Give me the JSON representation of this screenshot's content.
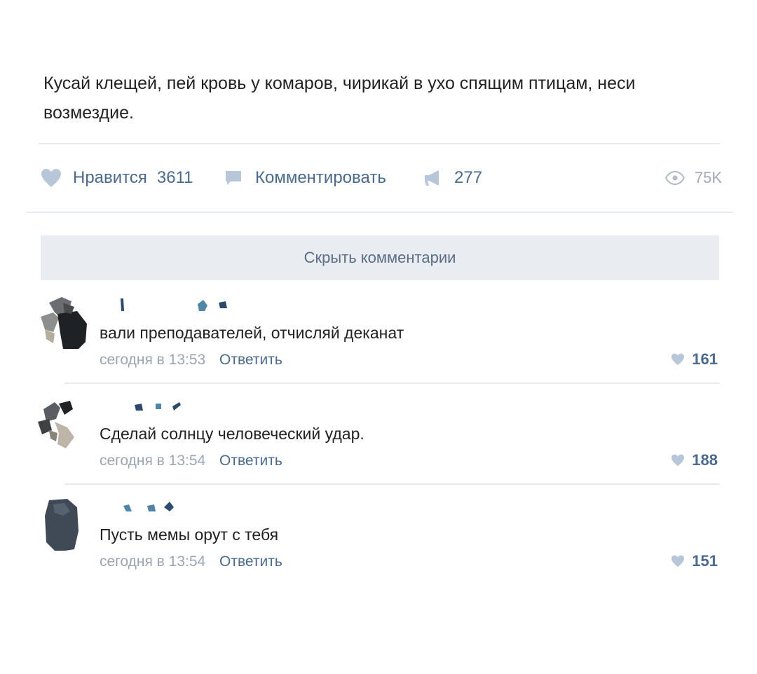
{
  "post": {
    "text": "Кусай клещей, пей кровь у комаров, чирикай в ухо спящим птицам, неси возмездие."
  },
  "actions": {
    "like_label": "Нравится",
    "like_count": "3611",
    "comment_label": "Комментировать",
    "share_count": "277",
    "views_count": "75K"
  },
  "hide_comments_label": "Скрыть комментарии",
  "comments": [
    {
      "text": "вали преподавателей, отчисляй деканат",
      "time": "сегодня в 13:53",
      "reply_label": "Ответить",
      "likes": "161"
    },
    {
      "text": "Сделай солнцу человеческий удар.",
      "time": "сегодня в 13:54",
      "reply_label": "Ответить",
      "likes": "188"
    },
    {
      "text": "Пусть мемы орут с тебя",
      "time": "сегодня в 13:54",
      "reply_label": "Ответить",
      "likes": "151"
    }
  ],
  "colors": {
    "link": "#4a6a8f",
    "muted": "#9aa5b2",
    "bar": "#e9ecf1",
    "heart": "#b7c7d9"
  }
}
